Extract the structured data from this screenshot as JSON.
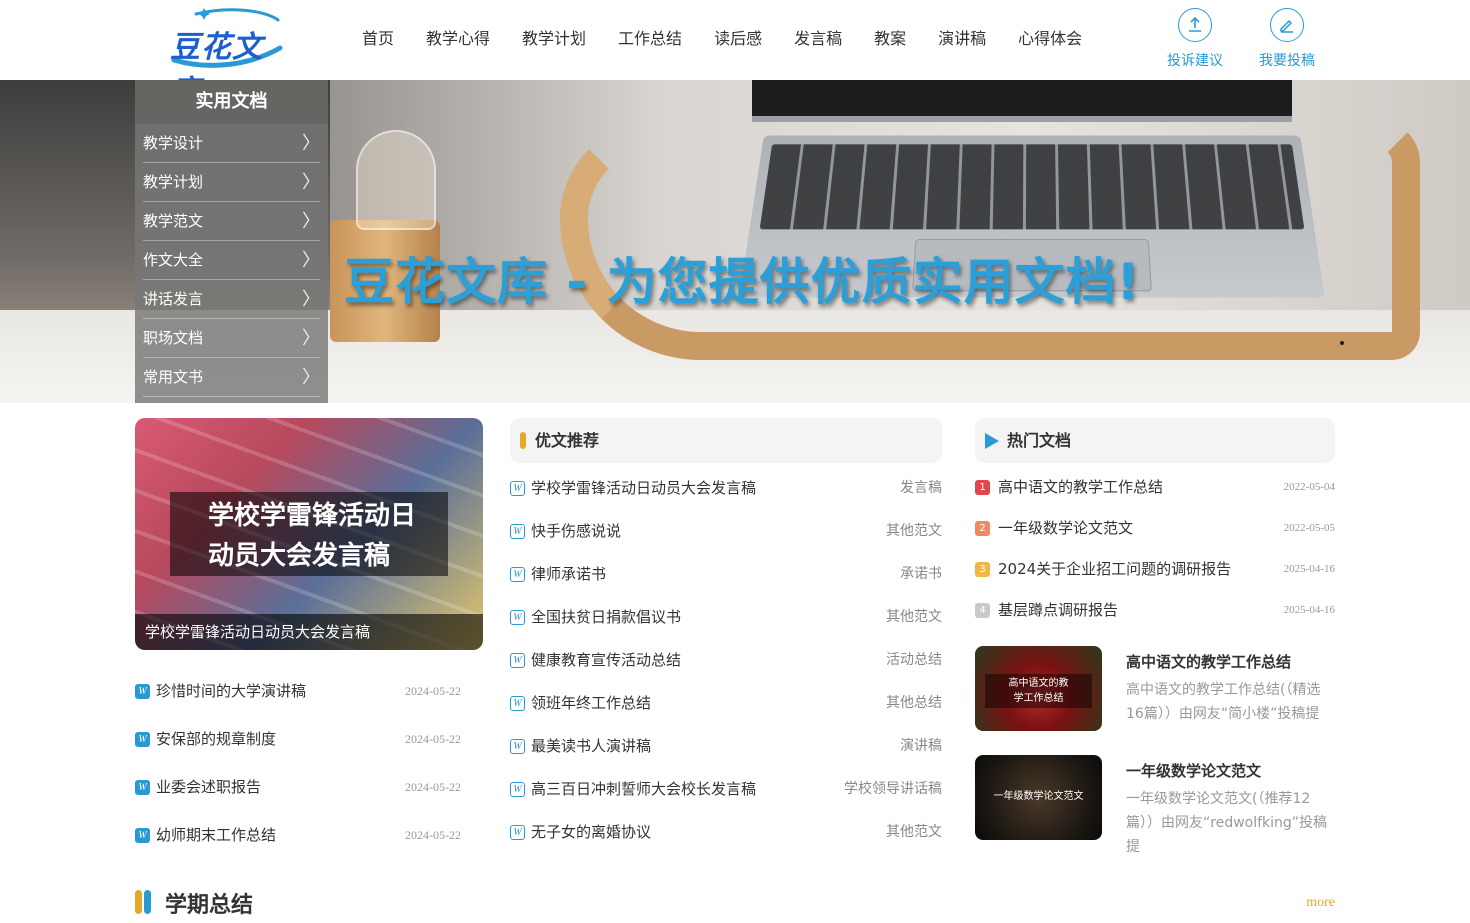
{
  "header": {
    "logo_text": "豆花文库",
    "nav": [
      "首页",
      "教学心得",
      "教学计划",
      "工作总结",
      "读后感",
      "发言稿",
      "教案",
      "演讲稿",
      "心得体会"
    ],
    "tools": [
      {
        "label": "投诉建议",
        "icon": "upload-icon"
      },
      {
        "label": "我要投稿",
        "icon": "edit-icon"
      }
    ]
  },
  "banner": {
    "title": "豆花文库 - 为您提供优质实用文档!"
  },
  "side_menu": {
    "title": "实用文档",
    "items": [
      "教学设计",
      "教学计划",
      "教学范文",
      "作文大全",
      "讲话发言",
      "职场文档",
      "常用文书"
    ]
  },
  "featured": {
    "overlay_line1": "学校学雷锋活动日",
    "overlay_line2": "动员大会发言稿",
    "caption": "学校学雷锋活动日动员大会发言稿"
  },
  "left_list": [
    {
      "title": "珍惜时间的大学演讲稿",
      "date": "2024-05-22"
    },
    {
      "title": "安保部的规章制度",
      "date": "2024-05-22"
    },
    {
      "title": "业委会述职报告",
      "date": "2024-05-22"
    },
    {
      "title": "幼师期末工作总结",
      "date": "2024-05-22"
    }
  ],
  "recommended": {
    "title": "优文推荐",
    "items": [
      {
        "title": "学校学雷锋活动日动员大会发言稿",
        "category": "发言稿"
      },
      {
        "title": "快手伤感说说",
        "category": "其他范文"
      },
      {
        "title": "律师承诺书",
        "category": "承诺书"
      },
      {
        "title": "全国扶贫日捐款倡议书",
        "category": "其他范文"
      },
      {
        "title": "健康教育宣传活动总结",
        "category": "活动总结"
      },
      {
        "title": "领班年终工作总结",
        "category": "其他总结"
      },
      {
        "title": "最美读书人演讲稿",
        "category": "演讲稿"
      },
      {
        "title": "高三百日冲刺誓师大会校长发言稿",
        "category": "学校领导讲话稿"
      },
      {
        "title": "无子女的离婚协议",
        "category": "其他范文"
      }
    ]
  },
  "hot": {
    "title": "热门文档",
    "items": [
      {
        "rank": "1",
        "title": "高中语文的教学工作总结",
        "date": "2022-05-04",
        "color": "#e0464e"
      },
      {
        "rank": "2",
        "title": "一年级数学论文范文",
        "date": "2022-05-05",
        "color": "#ee8a5e"
      },
      {
        "rank": "3",
        "title": "2024关于企业招工问题的调研报告",
        "date": "2025-04-16",
        "color": "#f0b64a"
      },
      {
        "rank": "4",
        "title": "基层蹲点调研报告",
        "date": "2025-04-16",
        "color": "#c9c9c9"
      }
    ],
    "cards": [
      {
        "thumb_line1": "高中语文的教",
        "thumb_line2": "学工作总结",
        "title": "高中语文的教学工作总结",
        "desc_line1": "高中语文的教学工作总结(（精选",
        "desc_line2": "16篇））由网友“简小楼”投稿提"
      },
      {
        "thumb_line1": "一年级数学论文范文",
        "title": "一年级数学论文范文",
        "desc_line1": "一年级数学论文范文(（推荐12",
        "desc_line2": "篇））由网友“redwolfking”投稿提"
      }
    ]
  },
  "term_section": {
    "title": "学期总结",
    "more": "more"
  },
  "colors": {
    "accent_blue": "#2a9ad4",
    "accent_yellow": "#e3a92c",
    "logo_blue": "#1d5fd1"
  }
}
